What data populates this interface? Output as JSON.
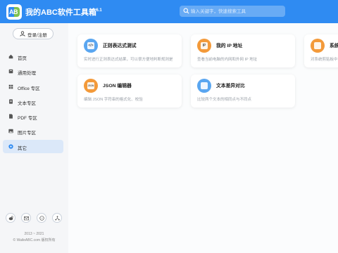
{
  "header": {
    "logo_text": "AB",
    "title": "我的ABC软件工具箱",
    "version": "v6.6.1",
    "search_placeholder": "输入关键字，快速搜索工具"
  },
  "sidebar": {
    "login_label": "登录/注册",
    "items": [
      {
        "label": "首页",
        "icon": "home-icon",
        "active": false
      },
      {
        "label": "通用处理",
        "icon": "box-icon",
        "active": false
      },
      {
        "label": "Office 专区",
        "icon": "office-icon",
        "active": false
      },
      {
        "label": "文本专区",
        "icon": "text-doc-icon",
        "active": false
      },
      {
        "label": "PDF 专区",
        "icon": "pdf-icon",
        "active": false
      },
      {
        "label": "图片专区",
        "icon": "image-icon",
        "active": false
      },
      {
        "label": "其它",
        "icon": "more-icon",
        "active": true
      }
    ],
    "social_icons": [
      "weibo-icon",
      "mail-icon",
      "chat-icon",
      "share-icon"
    ],
    "copyright_years": "2013 ~ 2021",
    "copyright_text": "© WaileABC.com 版权所有"
  },
  "cards": [
    {
      "title": "正则表达式测试",
      "desc": "实时进行正则表达式结果，可以很方便地判断规则是",
      "icon": "code-icon",
      "color": "#5aa6f0",
      "glyph": "</>"
    },
    {
      "title": "我的 IP 地址",
      "desc": "查看当前电脑的内网和外网 IP 地址",
      "icon": "ip-icon",
      "color": "#f39a3a",
      "glyph": "IP"
    },
    {
      "title": "系统",
      "desc": "对系统剪贴板中",
      "icon": "monitor-icon",
      "color": "#f39a3a",
      "glyph": ""
    },
    {
      "title": "JSON 编辑器",
      "desc": "编辑 JSON 字符串的格式化、校验",
      "icon": "json-icon",
      "color": "#f39a3a",
      "glyph": "JSON"
    },
    {
      "title": "文本差异对比",
      "desc": "比较两个文本的相同点与不同点",
      "icon": "diff-icon",
      "color": "#5aa6f0",
      "glyph": ""
    }
  ],
  "colors": {
    "header": "#2f8bf2",
    "active_nav": "#dbe8f9",
    "orange": "#f39a3a",
    "blue": "#5aa6f0"
  }
}
